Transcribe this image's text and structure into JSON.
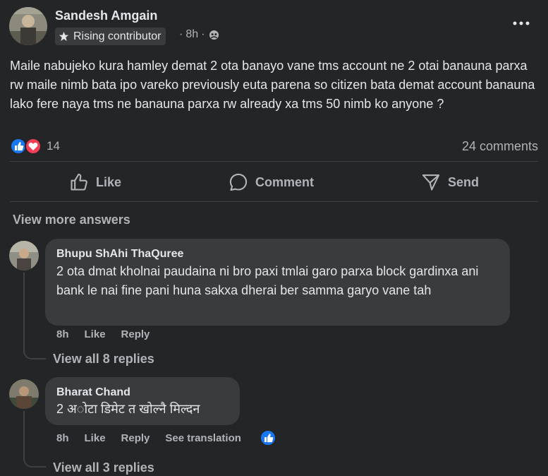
{
  "post": {
    "author": "Sandesh Amgain",
    "badge": "Rising contributor",
    "time": "8h",
    "separator": "·",
    "text": "Maile nabujeko kura hamley demat 2 ota banayo vane tms account ne 2 otai banauna parxa rw maile nimb bata ipo vareko previously euta parena so citizen bata demat account banauna lako fere naya tms ne banauna parxa rw already xa tms 50 nimb ko anyone ?",
    "reaction_count": "14",
    "comments_count": "24 comments",
    "icons": [
      "star-icon",
      "globe-icon",
      "more-options-icon",
      "like-reaction-icon",
      "love-reaction-icon"
    ]
  },
  "actions": {
    "like": "Like",
    "comment": "Comment",
    "send": "Send"
  },
  "view_more": "View more answers",
  "comments": [
    {
      "author": "Bhupu ShAhi ThaQuree",
      "text": "2 ota dmat kholnai paudaina ni bro paxi tmlai garo parxa block gardinxa ani bank le nai fine pani huna sakxa dherai ber samma garyo vane tah",
      "time": "8h",
      "like": "Like",
      "reply": "Reply",
      "view_replies": "View all 8 replies"
    },
    {
      "author": "Bharat Chand",
      "text": "2 अोटा डिमेट त खोल्नै मिल्दन",
      "time": "8h",
      "like": "Like",
      "reply": "Reply",
      "see_translation": "See translation",
      "view_replies": "View all 3 replies"
    }
  ],
  "colors": {
    "background": "#242526",
    "bubble": "#3a3b3c",
    "text_primary": "#e4e6eb",
    "text_secondary": "#b0b3b8",
    "like_blue": "#1877f2",
    "love_red": "#f33e58"
  }
}
